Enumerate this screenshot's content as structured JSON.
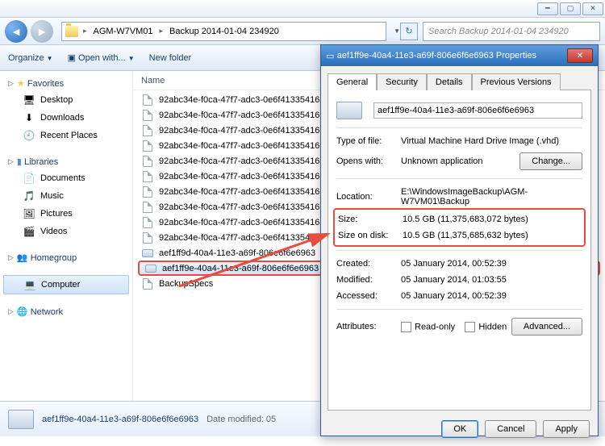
{
  "window_controls": {
    "min": "━",
    "max": "▢",
    "close": "✕"
  },
  "breadcrumb": {
    "seg1": "AGM-W7VM01",
    "seg2": "Backup 2014-01-04 234920"
  },
  "search": {
    "placeholder": "Search Backup 2014-01-04 234920"
  },
  "toolbar": {
    "organize": "Organize",
    "open_with": "Open with...",
    "new_folder": "New folder"
  },
  "sidebar": {
    "favorites": {
      "label": "Favorites",
      "items": [
        "Desktop",
        "Downloads",
        "Recent Places"
      ]
    },
    "libraries": {
      "label": "Libraries",
      "items": [
        "Documents",
        "Music",
        "Pictures",
        "Videos"
      ]
    },
    "homegroup": {
      "label": "Homegroup"
    },
    "computer": {
      "label": "Computer"
    },
    "network": {
      "label": "Network"
    }
  },
  "list": {
    "header": "Name",
    "rows": [
      "92abc34e-f0ca-47f7-adc3-0e6f41335416",
      "92abc34e-f0ca-47f7-adc3-0e6f41335416",
      "92abc34e-f0ca-47f7-adc3-0e6f41335416",
      "92abc34e-f0ca-47f7-adc3-0e6f41335416",
      "92abc34e-f0ca-47f7-adc3-0e6f41335416",
      "92abc34e-f0ca-47f7-adc3-0e6f41335416",
      "92abc34e-f0ca-47f7-adc3-0e6f41335416",
      "92abc34e-f0ca-47f7-adc3-0e6f41335416",
      "92abc34e-f0ca-47f7-adc3-0e6f41335416",
      "92abc34e-f0ca-47f7-adc3-0e6f41335416",
      "aef1ff9d-40a4-11e3-a69f-806e6f6e6963",
      "aef1ff9e-40a4-11e3-a69f-806e6f6e6963",
      "BackupSpecs"
    ],
    "selected_index": 11
  },
  "status": {
    "name": "aef1ff9e-40a4-11e3-a69f-806e6f6e6963",
    "date_label": "Date modified:",
    "date_val": "05"
  },
  "props": {
    "title": "aef1ff9e-40a4-11e3-a69f-806e6f6e6963 Properties",
    "tabs": [
      "General",
      "Security",
      "Details",
      "Previous Versions"
    ],
    "filename": "aef1ff9e-40a4-11e3-a69f-806e6f6e6963",
    "type_label": "Type of file:",
    "type_val": "Virtual Machine Hard Drive Image (.vhd)",
    "opens_label": "Opens with:",
    "opens_val": "Unknown application",
    "change": "Change...",
    "location_label": "Location:",
    "location_val": "E:\\WindowsImageBackup\\AGM-W7VM01\\Backup",
    "size_label": "Size:",
    "size_val": "10.5 GB (11,375,683,072 bytes)",
    "sod_label": "Size on disk:",
    "sod_val": "10.5 GB (11,375,685,632 bytes)",
    "created_label": "Created:",
    "created_val": "05 January 2014, 00:52:39",
    "modified_label": "Modified:",
    "modified_val": "05 January 2014, 01:03:55",
    "accessed_label": "Accessed:",
    "accessed_val": "05 January 2014, 00:52:39",
    "attr_label": "Attributes:",
    "readonly": "Read-only",
    "hidden": "Hidden",
    "advanced": "Advanced...",
    "ok": "OK",
    "cancel": "Cancel",
    "apply": "Apply"
  }
}
